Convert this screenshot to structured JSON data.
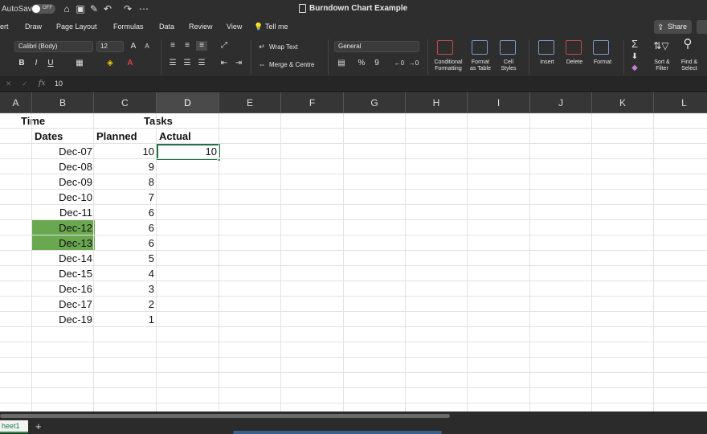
{
  "titlebar": {
    "autosave_label": "AutoSave",
    "autosave_state": "OFF",
    "document_title": "Burndown Chart Example",
    "icons": [
      "home-icon",
      "save-icon",
      "edit-icon",
      "undo-icon",
      "redo-icon",
      "customize-icon"
    ]
  },
  "menu": {
    "items": [
      "ert",
      "Draw",
      "Page Layout",
      "Formulas",
      "Data",
      "Review",
      "View"
    ],
    "tell_me": "Tell me",
    "share": "Share"
  },
  "ribbon": {
    "font_name": "Calibri (Body)",
    "font_size": "12",
    "wrap_text": "Wrap Text",
    "merge_centre": "Merge & Centre",
    "number_format": "General",
    "bold": "B",
    "italic": "I",
    "underline": "U",
    "percent": "%",
    "comma": "9",
    "labels": {
      "conditional_formatting_1": "Conditional",
      "conditional_formatting_2": "Formatting",
      "format_as_table_1": "Format",
      "format_as_table_2": "as Table",
      "cell_styles_1": "Cell",
      "cell_styles_2": "Styles",
      "insert": "Insert",
      "delete": "Delete",
      "format": "Format",
      "sort_filter_1": "Sort &",
      "sort_filter_2": "Filter",
      "find_select_1": "Find &",
      "find_select_2": "Select"
    }
  },
  "formula_bar": {
    "fx": "fx",
    "value": "10"
  },
  "columns": [
    "A",
    "B",
    "C",
    "D",
    "E",
    "F",
    "G",
    "H",
    "I",
    "J",
    "K",
    "L"
  ],
  "active_column": "D",
  "sheet": {
    "header_row1": {
      "time": "Time",
      "tasks": "Tasks"
    },
    "header_row2": {
      "dates": "Dates",
      "planned": "Planned",
      "actual": "Actual"
    },
    "rows": [
      {
        "date": "Dec-07",
        "planned": "10",
        "actual": "10"
      },
      {
        "date": "Dec-08",
        "planned": "9",
        "actual": ""
      },
      {
        "date": "Dec-09",
        "planned": "8",
        "actual": ""
      },
      {
        "date": "Dec-10",
        "planned": "7",
        "actual": ""
      },
      {
        "date": "Dec-11",
        "planned": "6",
        "actual": ""
      },
      {
        "date": "Dec-12",
        "planned": "6",
        "actual": "",
        "highlight": true
      },
      {
        "date": "Dec-13",
        "planned": "6",
        "actual": "",
        "highlight": true
      },
      {
        "date": "Dec-14",
        "planned": "5",
        "actual": ""
      },
      {
        "date": "Dec-15",
        "planned": "4",
        "actual": ""
      },
      {
        "date": "Dec-16",
        "planned": "3",
        "actual": ""
      },
      {
        "date": "Dec-17",
        "planned": "2",
        "actual": ""
      },
      {
        "date": "Dec-19",
        "planned": "1",
        "actual": ""
      }
    ],
    "highlight_color": "#6aa84f",
    "selection_color": "#217346"
  },
  "tabs": {
    "sheet_name": "heet1",
    "add": "+"
  }
}
